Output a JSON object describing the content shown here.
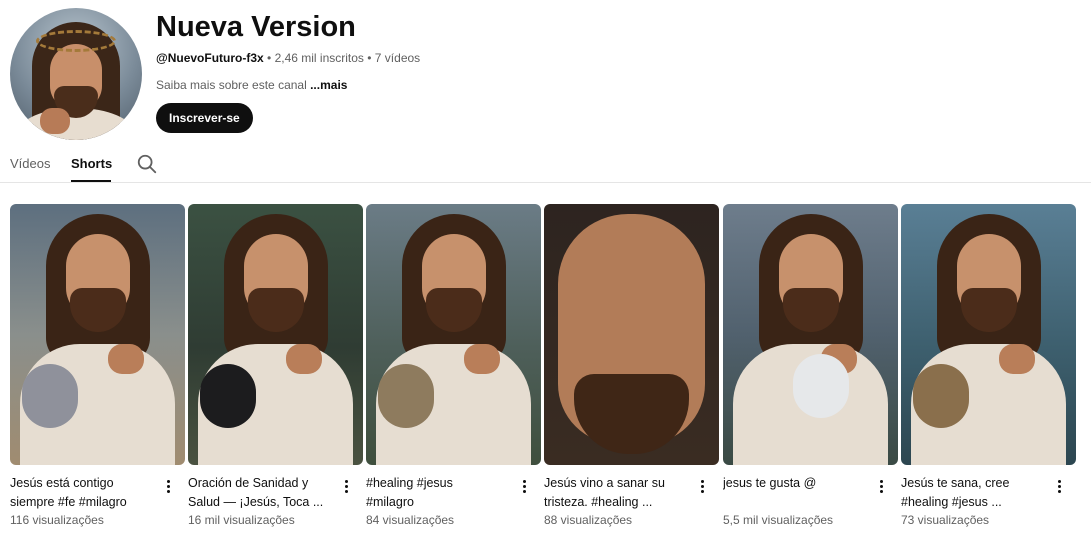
{
  "channel": {
    "title": "Nueva Version",
    "handle": "@NuevoFuturo-f3x",
    "stats": " • 2,46 mil inscritos • 7 vídeos",
    "about": "Saiba mais sobre este canal ",
    "about_more": "...mais",
    "subscribe_label": "Inscrever-se"
  },
  "tabs": [
    {
      "label": "Vídeos"
    },
    {
      "label": "Shorts"
    }
  ],
  "tab_search_icon": "search-icon",
  "shorts": [
    {
      "title": "Jesús está contigo\nsiempre #fe #milagro",
      "views": "116 visualizações"
    },
    {
      "title": "Oración de Sanidad y\nSalud — ¡Jesús, Toca ...",
      "views": "16 mil visualizações"
    },
    {
      "title": "#healing #jesus\n#milagro",
      "views": "84 visualizações"
    },
    {
      "title": "Jesús vino a sanar su\ntristeza.  #healing ...",
      "views": "88 visualizações"
    },
    {
      "title": "jesus te gusta @",
      "views": "5,5 mil visualizações"
    },
    {
      "title": "Jesús te sana, cree\n#healing #jesus ...",
      "views": "73 visualizações"
    }
  ],
  "menu_icon": "more-vert-icon"
}
